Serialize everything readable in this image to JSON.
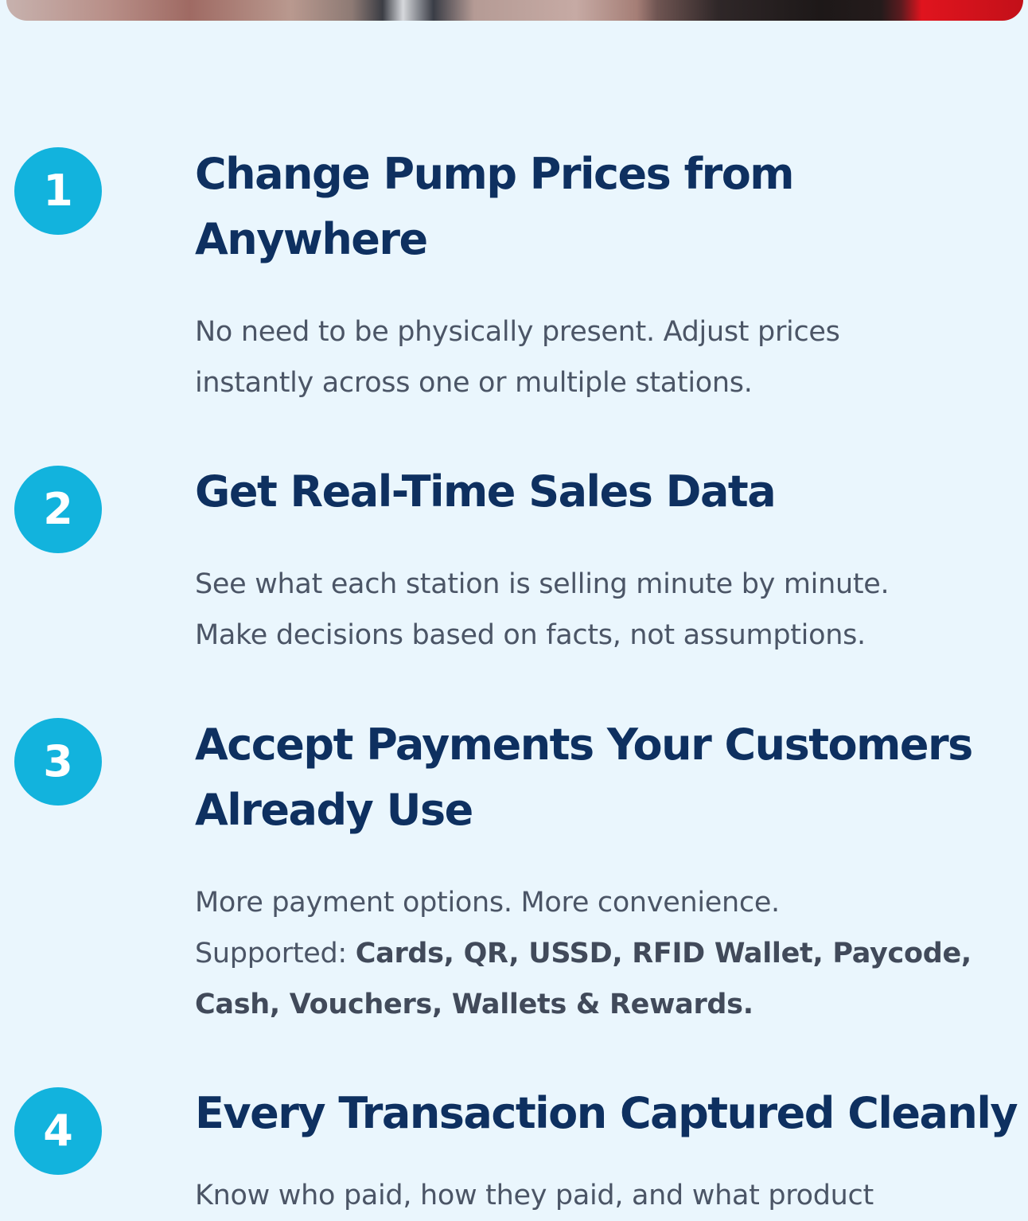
{
  "steps": [
    {
      "number": "1",
      "title_lines": [
        "Change Pump Prices from",
        "Anywhere"
      ],
      "desc_lines": [
        "No need to be physically present. Adjust prices",
        "instantly across one or multiple stations."
      ]
    },
    {
      "number": "2",
      "title_lines": [
        "Get Real-Time Sales Data"
      ],
      "desc_lines": [
        "See what each station is selling minute by minute.",
        "Make decisions based on facts, not assumptions."
      ]
    },
    {
      "number": "3",
      "title_lines": [
        "Accept Payments Your Customers",
        "Already Use"
      ],
      "desc_lines": [
        "More payment options. More convenience."
      ],
      "supported_label": "Supported: ",
      "supported_bold_1": "Cards, QR, USSD, RFID Wallet, Paycode,",
      "supported_bold_2": "Cash, Vouchers, Wallets & Rewards."
    },
    {
      "number": "4",
      "title_lines": [
        "Every Transaction Captured Cleanly"
      ],
      "desc_lines": [
        "Know who paid, how they paid, and what product"
      ]
    }
  ]
}
